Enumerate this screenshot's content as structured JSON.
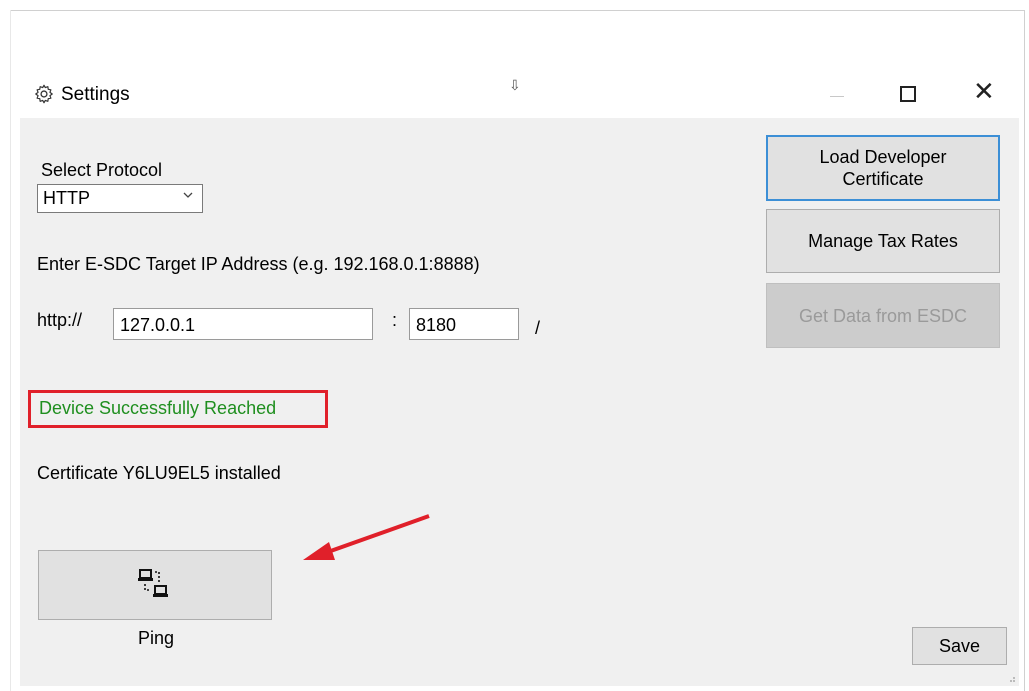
{
  "window": {
    "title": "Settings",
    "gear_icon": "gear-icon",
    "minimize_icon": "minimize-icon",
    "maximize_icon": "maximize-icon",
    "close_glyph": "✕"
  },
  "protocol": {
    "label": "Select Protocol",
    "selected": "HTTP"
  },
  "address": {
    "instruction": "Enter E-SDC Target IP Address (e.g. 192.168.0.1:8888)",
    "scheme": "http://",
    "ip": "127.0.0.1",
    "separator": ":",
    "port": "8180",
    "suffix": "/"
  },
  "status": {
    "message": "Device Successfully Reached",
    "message_color": "#1f8f1f",
    "highlight_color": "#e0202a"
  },
  "certificate_info": "Certificate Y6LU9EL5 installed",
  "buttons": {
    "load_cert": "Load Developer Certificate",
    "tax_rates": "Manage Tax Rates",
    "get_data": "Get Data from ESDC",
    "ping": "Ping",
    "save": "Save"
  },
  "annotation": {
    "arrow_color": "#e0202a"
  }
}
